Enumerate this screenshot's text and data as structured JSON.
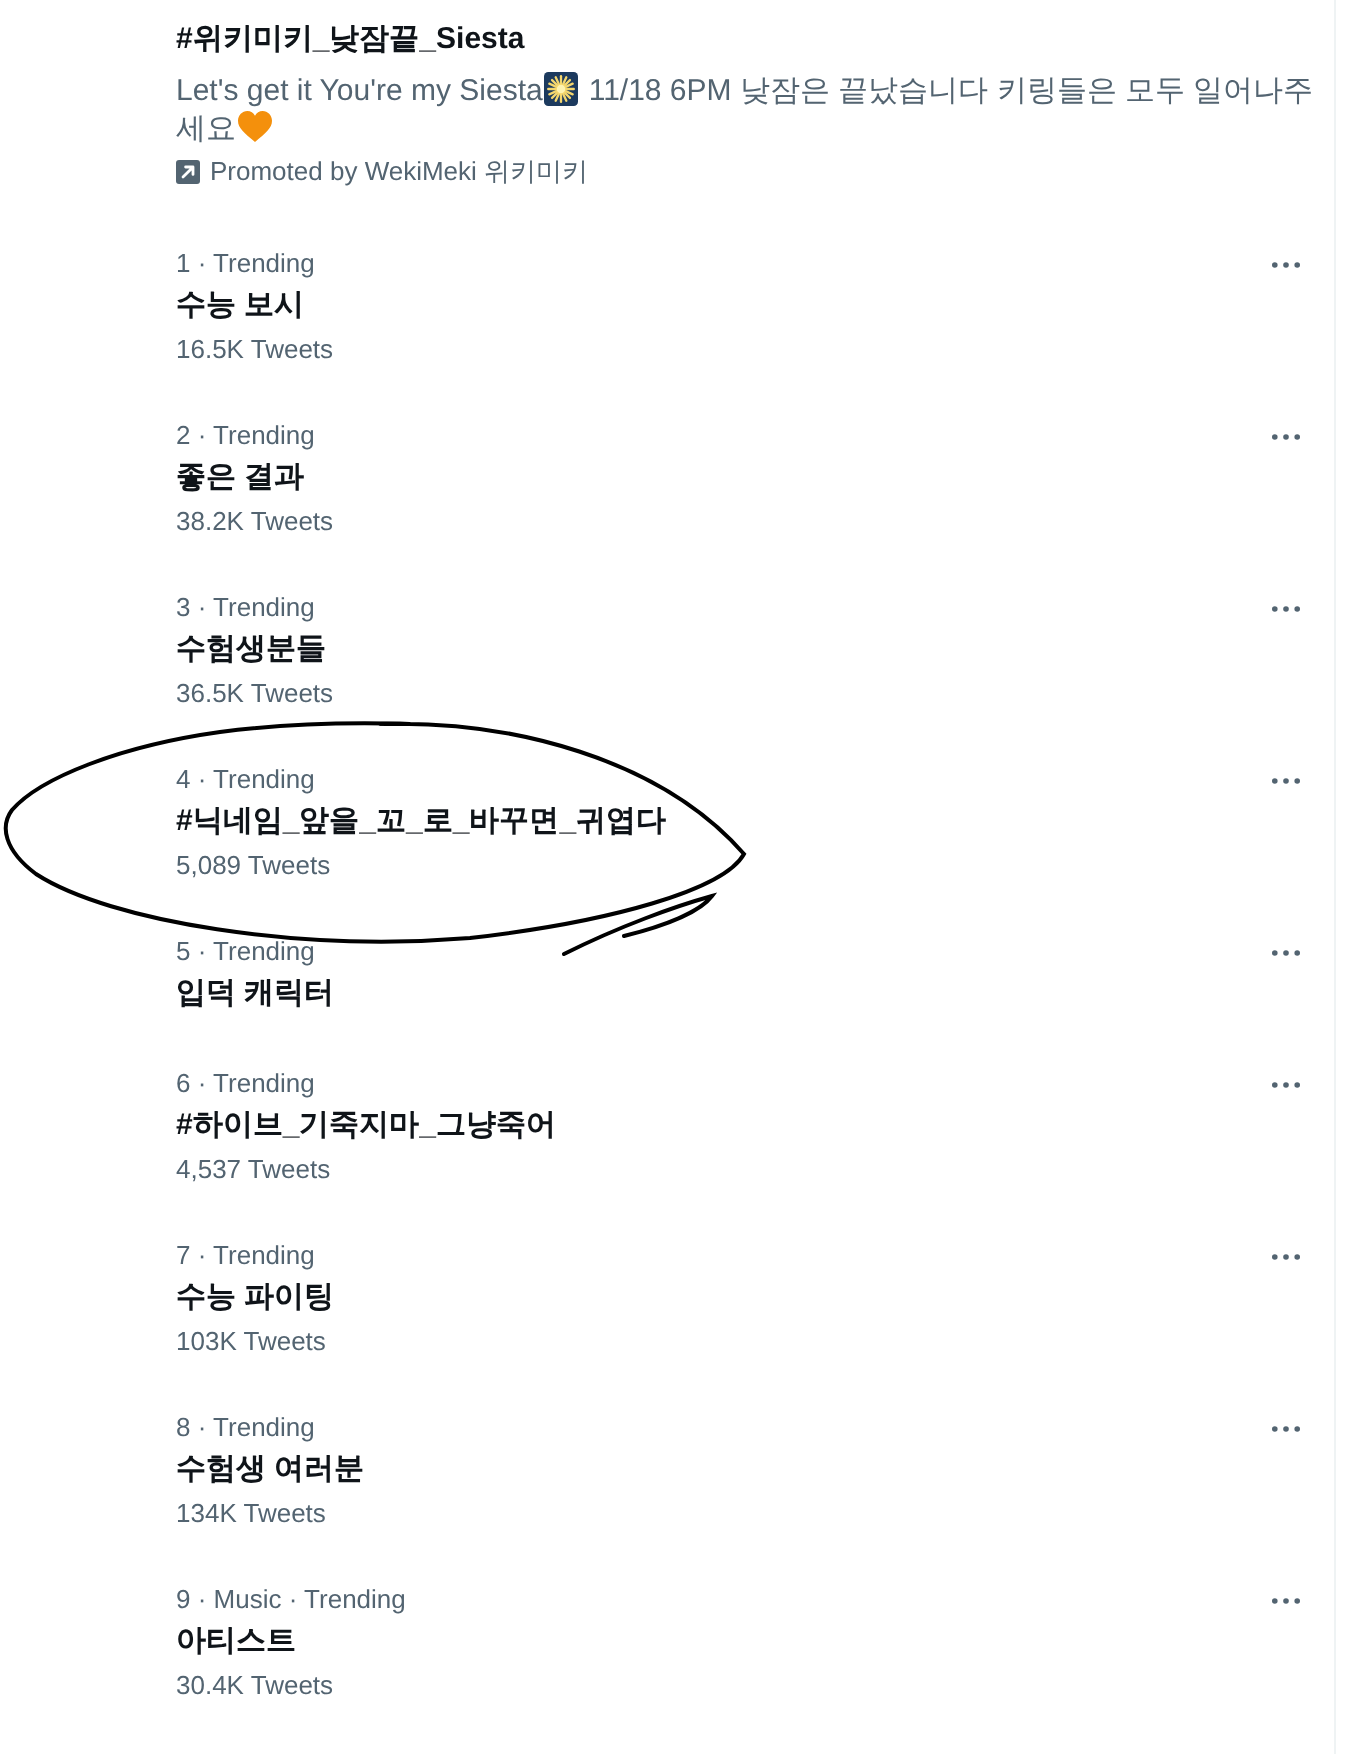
{
  "promoted_trend": {
    "title": "#위키미키_낮잠끝_Siesta",
    "description": [
      "Let's get it You're my Siesta",
      "11/18 6PM 낮잠은 끝났습니다 키링들은 모두 일어나주",
      "세요"
    ],
    "promoted_by": "Promoted by WekiMeki 위키미키"
  },
  "trends": [
    {
      "context": "1 · Trending",
      "name": "수능 보시",
      "tweet_count": "16.5K Tweets",
      "circled": false
    },
    {
      "context": "2 · Trending",
      "name": "좋은 결과",
      "tweet_count": "38.2K Tweets",
      "circled": false
    },
    {
      "context": "3 · Trending",
      "name": "수험생분들",
      "tweet_count": "36.5K Tweets",
      "circled": false
    },
    {
      "context": "4 · Trending",
      "name": "#닉네임_앞을_꼬_로_바꾸면_귀엽다",
      "tweet_count": "5,089 Tweets",
      "circled": true
    },
    {
      "context": "5 · Trending",
      "name": "입덕 캐릭터",
      "circled": false
    },
    {
      "context": "6 · Trending",
      "name": "#하이브_기죽지마_그냥죽어",
      "tweet_count": "4,537 Tweets",
      "circled": false
    },
    {
      "context": "7 · Trending",
      "name": "수능 파이팅",
      "tweet_count": "103K Tweets",
      "circled": false
    },
    {
      "context": "8 · Trending",
      "name": "수험생 여러분",
      "tweet_count": "134K Tweets",
      "circled": false
    },
    {
      "context": "9 · Music · Trending",
      "name": "아티스트",
      "tweet_count": "30.4K Tweets",
      "circled": false
    }
  ]
}
